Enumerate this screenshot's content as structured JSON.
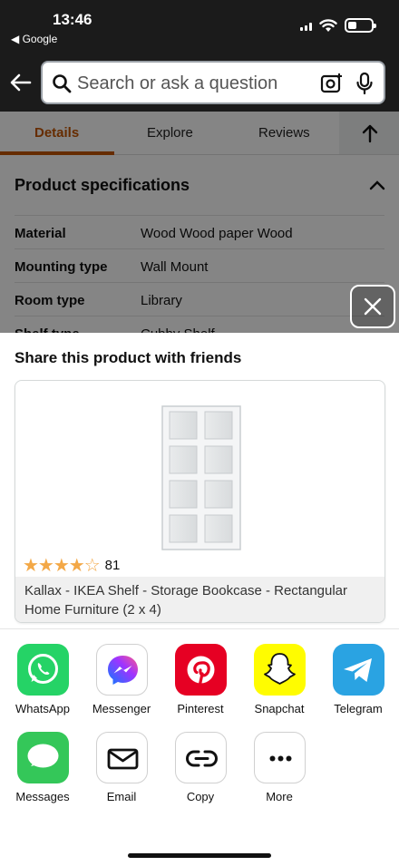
{
  "status": {
    "time": "13:46",
    "back_app": "◀ Google"
  },
  "search": {
    "placeholder": "Search or ask a question"
  },
  "tabs": [
    {
      "label": "Details",
      "active": true
    },
    {
      "label": "Explore"
    },
    {
      "label": "Reviews"
    }
  ],
  "specs": {
    "title": "Product specifications",
    "rows": [
      {
        "key": "Material",
        "value": "Wood Wood paper Wood"
      },
      {
        "key": "Mounting type",
        "value": "Wall Mount"
      },
      {
        "key": "Room type",
        "value": "Library"
      },
      {
        "key": "Shelf type",
        "value": "Cubby Shelf"
      }
    ]
  },
  "share": {
    "title": "Share this product with friends",
    "product": {
      "rating": 4.5,
      "stars_text": "★★★★",
      "empty_star": "☆",
      "review_count": "81",
      "title": "Kallax - IKEA Shelf - Storage Bookcase - Rectangular Home Furniture (2 x 4)"
    },
    "apps": [
      {
        "label": "WhatsApp",
        "icon": "whatsapp-icon",
        "color": "#25d366"
      },
      {
        "label": "Messenger",
        "icon": "messenger-icon",
        "color": "#a033ff"
      },
      {
        "label": "Pinterest",
        "icon": "pinterest-icon",
        "color": "#e60023"
      },
      {
        "label": "Snapchat",
        "icon": "snapchat-icon",
        "color": "#fffc00"
      },
      {
        "label": "Telegram",
        "icon": "telegram-icon",
        "color": "#2aa3e2"
      },
      {
        "label": "Messages",
        "icon": "messages-icon",
        "color": "#34c759"
      },
      {
        "label": "Email",
        "icon": "envelope-icon"
      },
      {
        "label": "Copy",
        "icon": "link-icon"
      },
      {
        "label": "More",
        "icon": "more-icon"
      }
    ]
  },
  "colors": {
    "accent": "#c45500",
    "header_bg": "#1b1b1b",
    "star": "#f3a847"
  }
}
